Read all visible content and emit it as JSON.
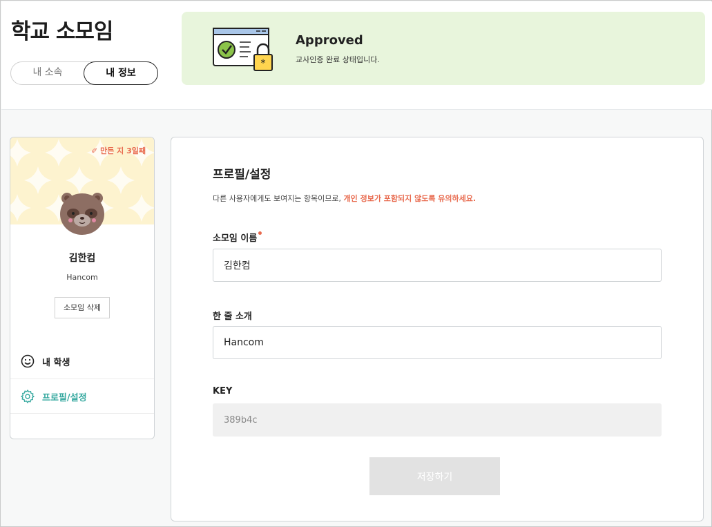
{
  "app": {
    "title": "학교 소모임"
  },
  "tabs": [
    {
      "label": "내 소속",
      "active": false
    },
    {
      "label": "내 정보",
      "active": true
    }
  ],
  "banner": {
    "status": "Approved",
    "description": "교사인증 완료 상태입니다.",
    "background": "#e8f5dc"
  },
  "profile": {
    "days_badge": "만든 지 3일째",
    "name": "김한컴",
    "sub": "Hancom",
    "delete_label": "소모임 삭제",
    "menu": [
      {
        "label": "내 학생",
        "icon": "smiley-icon",
        "active": false
      },
      {
        "label": "프로필/설정",
        "icon": "gear-icon",
        "active": true
      }
    ]
  },
  "settings": {
    "title": "프로필/설정",
    "notice_plain": "다른 사용자에게도 보여지는 항목이므로, ",
    "notice_warn": "개인 정보가 포함되지 않도록 유의하세요.",
    "name_label": "소모임 이름",
    "name_value": "김한컴",
    "intro_label": "한 줄 소개",
    "intro_value": "Hancom",
    "key_label": "KEY",
    "key_value": "389b4c",
    "save_label": "저장하기"
  },
  "colors": {
    "accent_teal": "#37a9a0",
    "warn": "#e86a4e",
    "cover": "#fdf3cf"
  }
}
